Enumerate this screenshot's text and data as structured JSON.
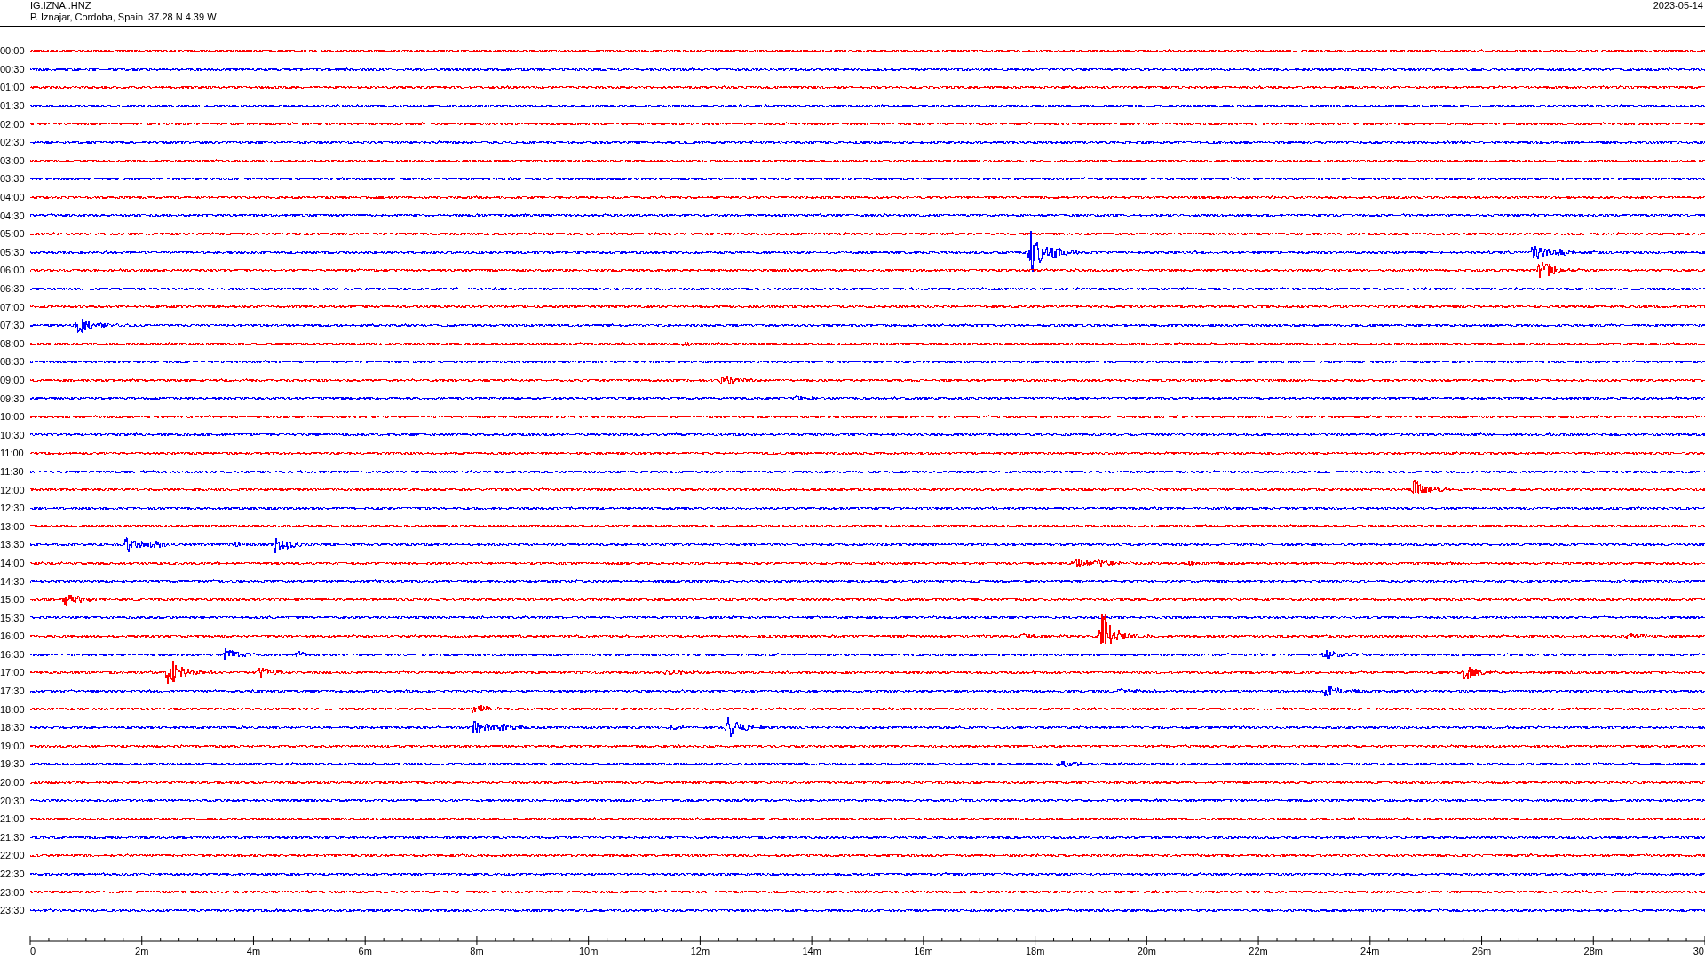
{
  "header": {
    "station": "IG.IZNA..HNZ",
    "location": "P. Iznajar, Cordoba, Spain  37.28 N 4.39 W",
    "date": "2023-05-14"
  },
  "rows": [
    {
      "label": "00:00",
      "color": "#ff0000"
    },
    {
      "label": "00:30",
      "color": "#0000ff"
    },
    {
      "label": "01:00",
      "color": "#ff0000"
    },
    {
      "label": "01:30",
      "color": "#0000ff"
    },
    {
      "label": "02:00",
      "color": "#ff0000"
    },
    {
      "label": "02:30",
      "color": "#0000ff"
    },
    {
      "label": "03:00",
      "color": "#ff0000"
    },
    {
      "label": "03:30",
      "color": "#0000ff"
    },
    {
      "label": "04:00",
      "color": "#ff0000"
    },
    {
      "label": "04:30",
      "color": "#0000ff"
    },
    {
      "label": "05:00",
      "color": "#ff0000"
    },
    {
      "label": "05:30",
      "color": "#0000ff"
    },
    {
      "label": "06:00",
      "color": "#ff0000"
    },
    {
      "label": "06:30",
      "color": "#0000ff"
    },
    {
      "label": "07:00",
      "color": "#ff0000"
    },
    {
      "label": "07:30",
      "color": "#0000ff"
    },
    {
      "label": "08:00",
      "color": "#ff0000"
    },
    {
      "label": "08:30",
      "color": "#0000ff"
    },
    {
      "label": "09:00",
      "color": "#ff0000"
    },
    {
      "label": "09:30",
      "color": "#0000ff"
    },
    {
      "label": "10:00",
      "color": "#ff0000"
    },
    {
      "label": "10:30",
      "color": "#0000ff"
    },
    {
      "label": "11:00",
      "color": "#ff0000"
    },
    {
      "label": "11:30",
      "color": "#0000ff"
    },
    {
      "label": "12:00",
      "color": "#ff0000"
    },
    {
      "label": "12:30",
      "color": "#0000ff"
    },
    {
      "label": "13:00",
      "color": "#ff0000"
    },
    {
      "label": "13:30",
      "color": "#0000ff"
    },
    {
      "label": "14:00",
      "color": "#ff0000"
    },
    {
      "label": "14:30",
      "color": "#0000ff"
    },
    {
      "label": "15:00",
      "color": "#ff0000"
    },
    {
      "label": "15:30",
      "color": "#0000ff"
    },
    {
      "label": "16:00",
      "color": "#ff0000"
    },
    {
      "label": "16:30",
      "color": "#0000ff"
    },
    {
      "label": "17:00",
      "color": "#ff0000"
    },
    {
      "label": "17:30",
      "color": "#0000ff"
    },
    {
      "label": "18:00",
      "color": "#ff0000"
    },
    {
      "label": "18:30",
      "color": "#0000ff"
    },
    {
      "label": "19:00",
      "color": "#ff0000"
    },
    {
      "label": "19:30",
      "color": "#0000ff"
    },
    {
      "label": "20:00",
      "color": "#ff0000"
    },
    {
      "label": "20:30",
      "color": "#0000ff"
    },
    {
      "label": "21:00",
      "color": "#ff0000"
    },
    {
      "label": "21:30",
      "color": "#0000ff"
    },
    {
      "label": "22:00",
      "color": "#ff0000"
    },
    {
      "label": "22:30",
      "color": "#0000ff"
    },
    {
      "label": "23:00",
      "color": "#ff0000"
    },
    {
      "label": "23:30",
      "color": "#0000ff"
    }
  ],
  "axis": {
    "labels": [
      "0",
      "2m",
      "4m",
      "6m",
      "8m",
      "10m",
      "12m",
      "14m",
      "16m",
      "18m",
      "20m",
      "22m",
      "24m",
      "26m",
      "28m",
      "30"
    ]
  }
}
